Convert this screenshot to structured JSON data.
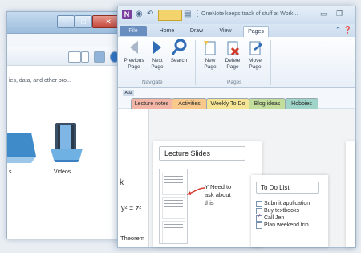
{
  "explorer": {
    "info_text": "ies, data, and other pro...",
    "video_label": "Videos",
    "left_label": "s"
  },
  "onenote": {
    "title": "OneNote keeps track of stuff at Work...",
    "tabs": [
      {
        "label": "File"
      },
      {
        "label": "Home"
      },
      {
        "label": "Draw"
      },
      {
        "label": "View"
      },
      {
        "label": "Pages"
      }
    ],
    "ribbon": {
      "navigate": {
        "previous": [
          "Previous",
          "Page"
        ],
        "next": [
          "Next",
          "Page"
        ],
        "search": "Search",
        "group": "Navigate"
      },
      "pages": {
        "new": [
          "New",
          "Page"
        ],
        "delete": [
          "Delete",
          "Page"
        ],
        "move": [
          "Move",
          "Page"
        ],
        "group": "Pages"
      }
    },
    "notebook_mini": "Add",
    "section_tabs": [
      {
        "label": "Lecture notes",
        "color": "#f3b5a6"
      },
      {
        "label": "Activities",
        "color": "#f9c98c"
      },
      {
        "label": "Weekly To Do",
        "color": "#f5e494"
      },
      {
        "label": "Blog ideas",
        "color": "#c2dd9c"
      },
      {
        "label": "Hobbies",
        "color": "#9ed5c8"
      }
    ],
    "page": {
      "left_k": "k",
      "equation": "y² = z²",
      "theorem": "Theorem",
      "slide_title": "Lecture Slides",
      "note": "Y Need to ask about this"
    },
    "todo": {
      "title": "To Do List",
      "items": [
        {
          "label": "Submit application",
          "checked": false
        },
        {
          "label": "Buy textbooks",
          "checked": false
        },
        {
          "label": "Call Jen",
          "checked": true
        },
        {
          "label": "Plan weekend trip",
          "checked": false
        }
      ]
    }
  }
}
